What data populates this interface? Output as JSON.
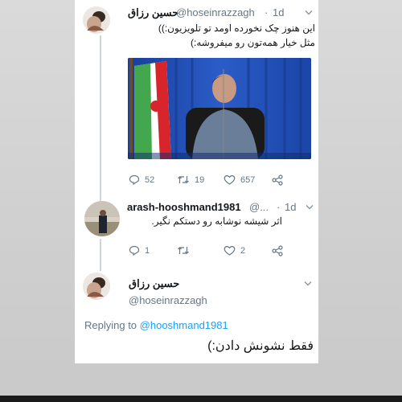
{
  "tweet1": {
    "name": "حسین رزاق",
    "handle": "@hoseinrazzagh",
    "sep": "·",
    "time": "1d",
    "text_line1": "این هنوز چک نخورده اومد تو تلویزیون:))",
    "text_line2": "مثل خیار همه‌تون رو میفروشه:)",
    "stats": {
      "replies": "52",
      "retweets": "19",
      "likes": "657"
    }
  },
  "tweet2": {
    "name": "arash-hooshmand1981",
    "handle": "@...",
    "sep": "·",
    "time": "1d",
    "text": "اثر شیشه نوشابه رو دستکم نگیر.",
    "stats": {
      "replies": "1",
      "retweets": "",
      "likes": "2"
    }
  },
  "tweet3": {
    "name": "حسین رزاق",
    "handle": "@hoseinrazzagh",
    "replying_label": "Replying to",
    "replying_handle": "@hooshmand1981",
    "text": "فقط نشونش دادن:)"
  },
  "colors": {
    "accent": "#1da1f2",
    "muted": "#657786",
    "thread": "#ccd6dd"
  },
  "icons": [
    "reply-icon",
    "retweet-icon",
    "like-icon",
    "share-icon",
    "chevron-down-icon"
  ]
}
